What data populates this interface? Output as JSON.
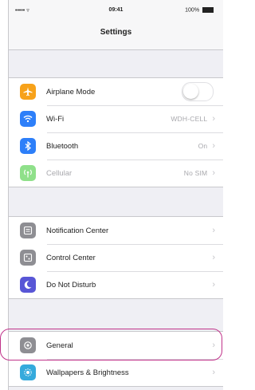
{
  "status_bar": {
    "signal": "••••• ▿",
    "time": "09:41",
    "battery": "100%"
  },
  "nav": {
    "title": "Settings"
  },
  "colors": {
    "airplane": "#f7a21a",
    "wifi": "#2d7ff9",
    "bluetooth": "#2d7ff9",
    "cellular": "#8fe08a",
    "notification": "#8e8e93",
    "control": "#8e8e93",
    "dnd": "#5856d6",
    "general": "#8e8e93",
    "wallpapers": "#35aadc",
    "highlight": "#c0338a"
  },
  "groups": [
    {
      "items": [
        {
          "label": "Airplane Mode",
          "icon": "airplane-icon",
          "accessory": "toggle",
          "toggle_on": false
        },
        {
          "label": "Wi-Fi",
          "icon": "wifi-icon",
          "value": "WDH-CELL"
        },
        {
          "label": "Bluetooth",
          "icon": "bluetooth-icon",
          "value": "On"
        },
        {
          "label": "Cellular",
          "icon": "cellular-icon",
          "value": "No SIM",
          "disabled": true
        }
      ]
    },
    {
      "items": [
        {
          "label": "Notification Center",
          "icon": "notification-center-icon"
        },
        {
          "label": "Control Center",
          "icon": "control-center-icon"
        },
        {
          "label": "Do Not Disturb",
          "icon": "moon-icon"
        }
      ]
    },
    {
      "items": [
        {
          "label": "General",
          "icon": "gear-icon",
          "highlighted": true
        },
        {
          "label": "Wallpapers & Brightness",
          "icon": "wallpaper-icon"
        }
      ]
    }
  ]
}
